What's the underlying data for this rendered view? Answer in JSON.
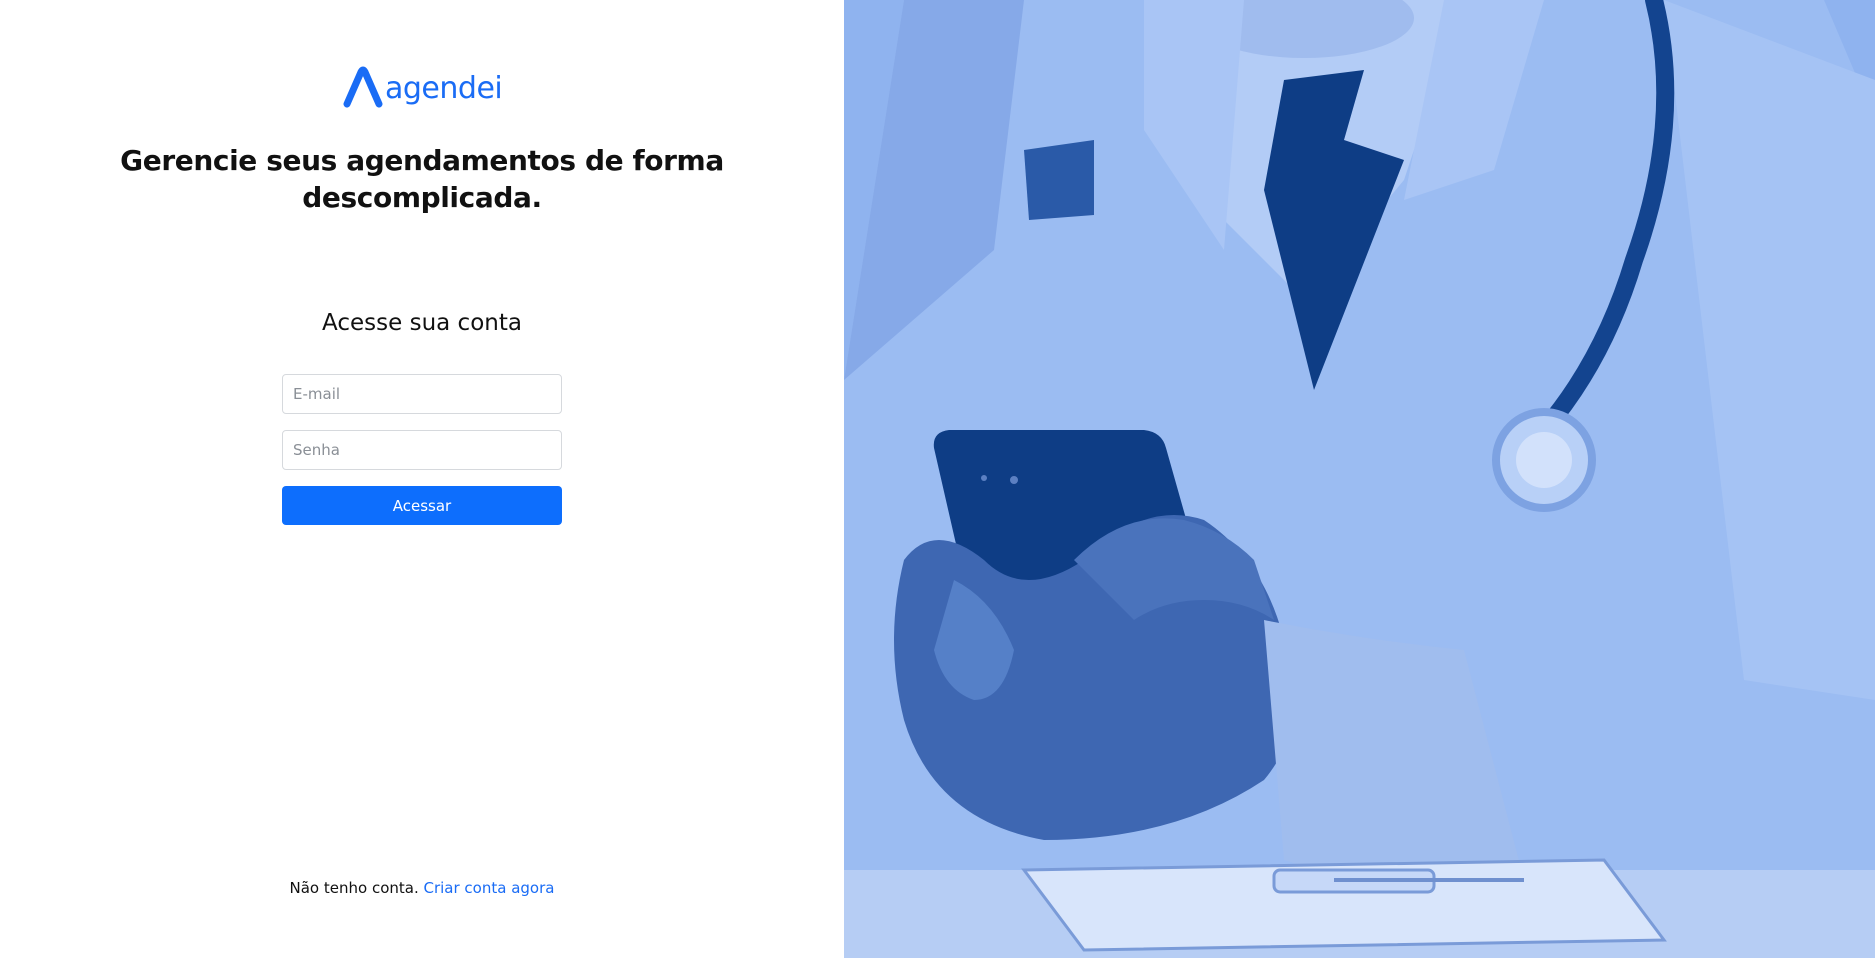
{
  "brand": {
    "name": "agendei",
    "accent_color": "#1a6cf5"
  },
  "hero": {
    "headline": "Gerencie seus agendamentos de forma descomplicada.",
    "image_subject": "doctor-with-smartphone",
    "overlay_color": "#8fb3ef"
  },
  "login": {
    "title": "Acesse sua conta",
    "email_placeholder": "E-mail",
    "password_placeholder": "Senha",
    "submit_label": "Acessar",
    "submit_color": "#0d6efd"
  },
  "footer": {
    "prompt": "Não tenho conta.",
    "signup_link": "Criar conta agora"
  }
}
